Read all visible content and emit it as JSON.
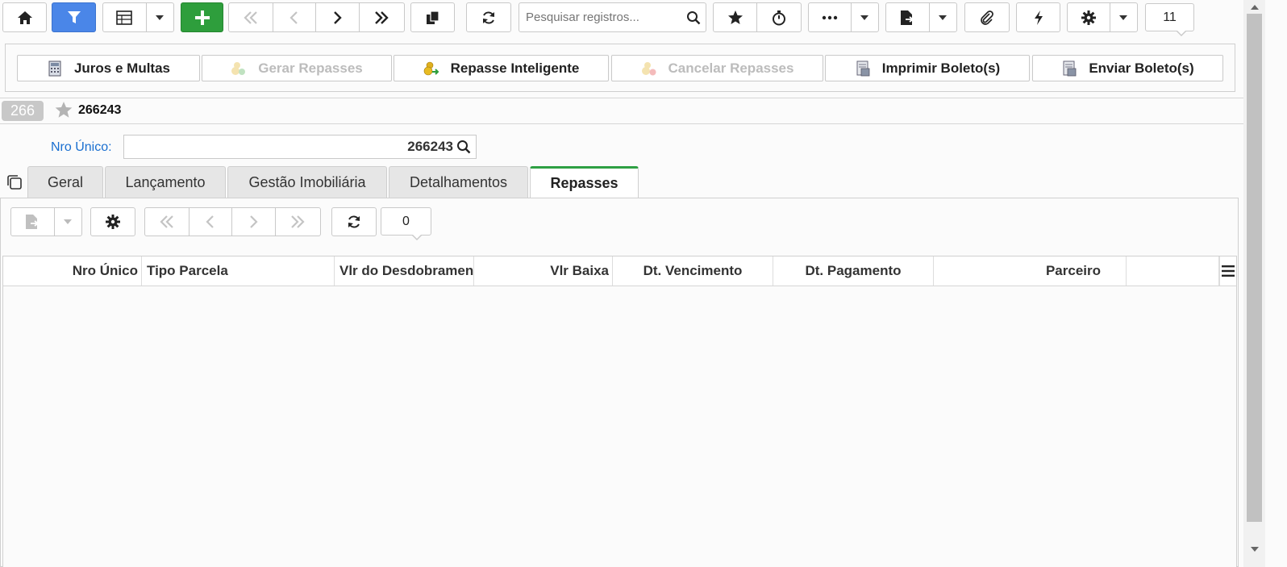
{
  "toolbar": {
    "search_placeholder": "Pesquisar registros...",
    "badge_count": "11",
    "icons": [
      "home-icon",
      "filter-icon",
      "table-icon",
      "plus-icon",
      "first-icon",
      "prev-icon",
      "next-icon",
      "last-icon",
      "copy-icon",
      "refresh-icon",
      "search-icon",
      "star-icon",
      "stopwatch-icon",
      "more-icon",
      "export-icon",
      "paperclip-icon",
      "lightning-icon",
      "gear-icon"
    ]
  },
  "actions": {
    "juros": "Juros e Multas",
    "gerar": "Gerar Repasses",
    "inteligente": "Repasse Inteligente",
    "cancelar": "Cancelar Repasses",
    "imprimir": "Imprimir Boleto(s)",
    "enviar": "Enviar Boleto(s)"
  },
  "record": {
    "badge": "266",
    "id": "266243"
  },
  "form": {
    "nro_unico_label": "Nro Único:",
    "nro_unico_value": "266243"
  },
  "tabs": [
    "Geral",
    "Lançamento",
    "Gestão Imobiliária",
    "Detalhamentos",
    "Repasses"
  ],
  "subtoolbar": {
    "count": "0"
  },
  "grid": {
    "columns": [
      "Nro Único",
      "Tipo Parcela",
      "Vlr do Desdobramento",
      "Vlr Baixa",
      "Dt. Vencimento",
      "Dt. Pagamento",
      "Parceiro"
    ],
    "rows": []
  },
  "colors": {
    "filter_blue": "#4a86e8",
    "add_green": "#2e9e3c",
    "active_tab": "#2ea043",
    "label_blue": "#1a6fd0"
  }
}
